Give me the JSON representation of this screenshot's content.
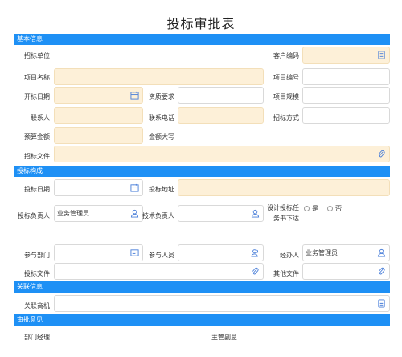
{
  "title": "投标审批表",
  "sections": {
    "basic": "基本信息",
    "bid": "投标构成",
    "related": "关联信息",
    "opinion": "审批意见"
  },
  "labels": {
    "bid_unit": "招标单位",
    "customer_code": "客户编码",
    "project_name": "项目名称",
    "project_no": "项目编号",
    "open_date": "开标日期",
    "qualification": "资质要求",
    "project_scale": "项目规模",
    "contact": "联系人",
    "contact_phone": "联系电话",
    "bid_method": "招标方式",
    "budget": "预算金额",
    "amount_upper": "金额大写",
    "bid_file": "招标文件",
    "bid_date": "投标日期",
    "bid_address": "投标地址",
    "bid_owner": "投标负责人",
    "tech_owner": "技术负责人",
    "design_doc": "设计投标任务书下达",
    "dept": "参与部门",
    "participants": "参与人员",
    "handler": "经办人",
    "tender_file": "投标文件",
    "other_file": "其他文件",
    "related_opp": "关联商机",
    "dept_manager": "部门经理",
    "vp": "主管副总"
  },
  "values": {
    "bid_owner": "业务管理员",
    "handler": "业务管理员"
  },
  "radio": {
    "yes": "是",
    "no": "否"
  },
  "colors": {
    "section_bg": "#1e90f5",
    "required_bg": "#fdf0d8",
    "icon": "#4a7fd9"
  }
}
